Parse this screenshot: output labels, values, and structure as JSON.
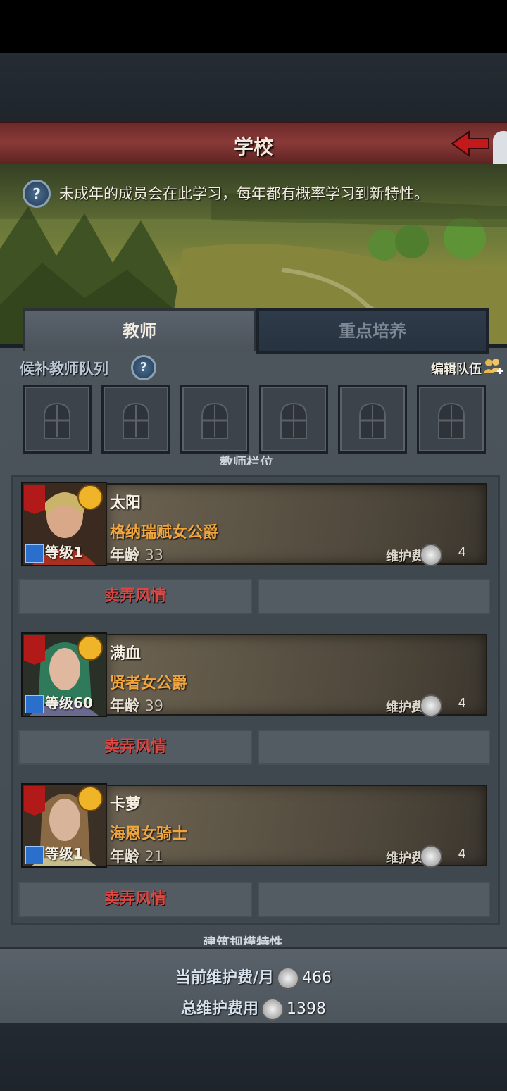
{
  "header": {
    "title": "学校"
  },
  "banner": {
    "description": "未成年的成员会在此学习，每年都有概率学习到新特性。"
  },
  "tabs": [
    {
      "label": "教师",
      "active": true
    },
    {
      "label": "重点培养",
      "active": false
    }
  ],
  "candidates": {
    "label": "候补教师队列",
    "edit_label": "编辑队伍",
    "slot_count": 6
  },
  "teacher_section_label": "教师栏位",
  "teachers": [
    {
      "name": "太阳",
      "title": "格纳瑞赋女公爵",
      "age_label": "年龄",
      "age": "33",
      "level_label": "等级1",
      "fee_label": "维护费",
      "fee": "4",
      "action": "卖弄风情"
    },
    {
      "name": "满血",
      "title": "贤者女公爵",
      "age_label": "年龄",
      "age": "39",
      "level_label": "等级60",
      "fee_label": "维护费",
      "fee": "4",
      "action": "卖弄风情"
    },
    {
      "name": "卡萝",
      "title": "海恩女骑士",
      "age_label": "年龄",
      "age": "21",
      "level_label": "等级1",
      "fee_label": "维护费",
      "fee": "4",
      "action": "卖弄风情"
    }
  ],
  "next_section_label": "建筑规模特性",
  "footer": {
    "monthly_label": "当前维护费/月",
    "monthly_value": "466",
    "total_label": "总维护费用",
    "total_value": "1398"
  },
  "colors": {
    "accent_red": "#d94844",
    "title_orange": "#f0a640"
  }
}
